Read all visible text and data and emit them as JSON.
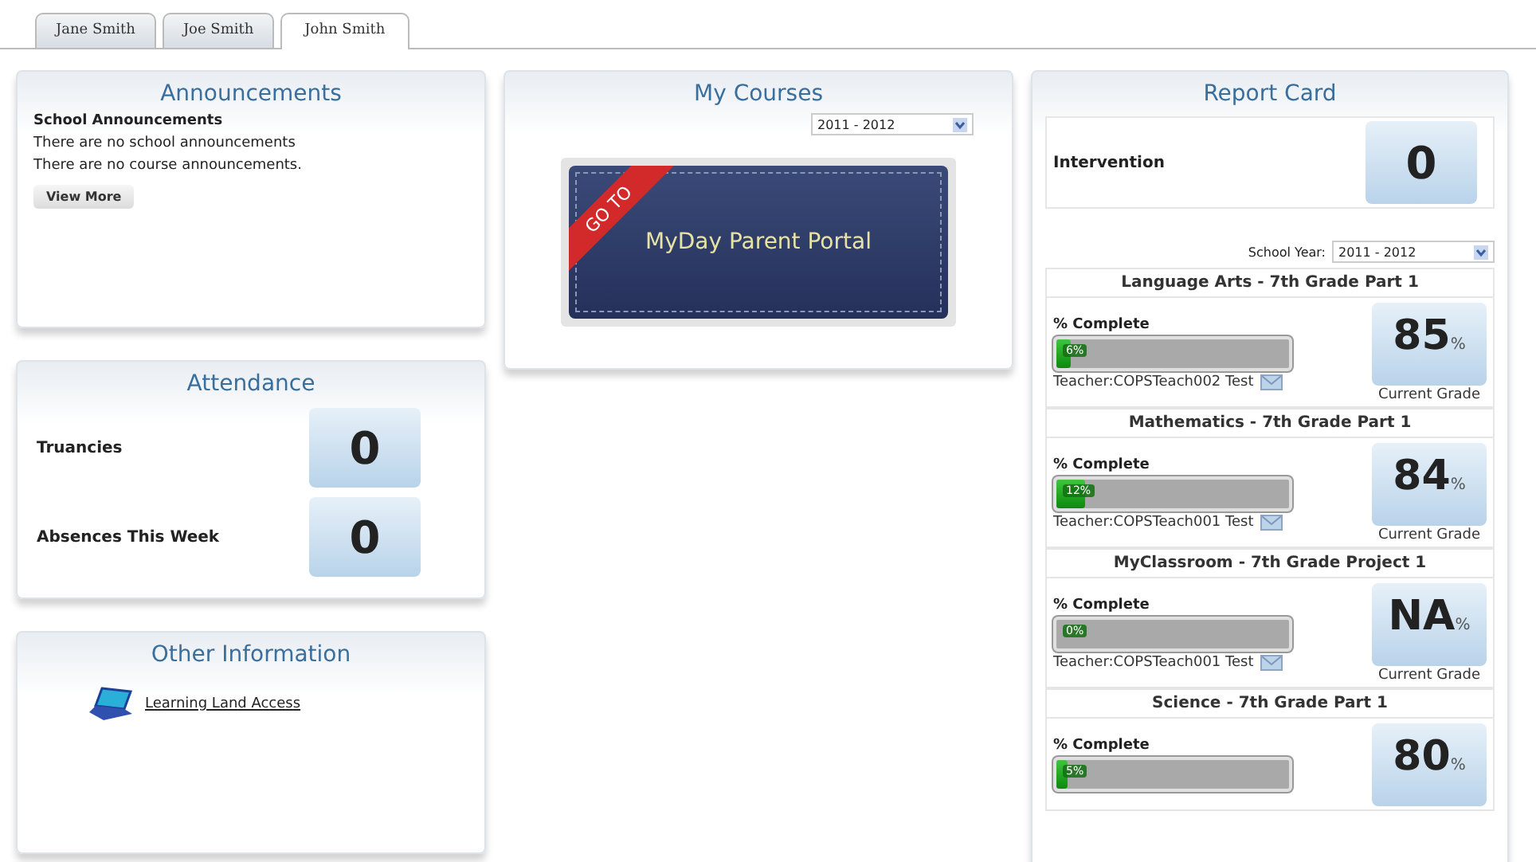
{
  "tabs": [
    {
      "label": "Jane Smith",
      "selected": false
    },
    {
      "label": "Joe Smith",
      "selected": false
    },
    {
      "label": "John Smith",
      "selected": true
    }
  ],
  "announcements": {
    "title": "Announcements",
    "heading": "School Announcements",
    "lines": [
      "There are no school announcements",
      "There are no course announcements."
    ],
    "button": "View More"
  },
  "attendance": {
    "title": "Attendance",
    "rows": [
      {
        "label": "Truancies",
        "value": "0"
      },
      {
        "label": "Absences This Week",
        "value": "0"
      }
    ]
  },
  "other_information": {
    "title": "Other Information",
    "links": [
      "Learning Land Access"
    ]
  },
  "my_courses": {
    "title": "My Courses",
    "year": "2011 - 2012",
    "banner_ribbon": "GO TO",
    "banner_text": "MyDay Parent Portal"
  },
  "report_card": {
    "title": "Report Card",
    "intervention": {
      "label": "Intervention",
      "value": "0"
    },
    "school_year_label": "School Year:",
    "school_year": "2011 - 2012",
    "courses": [
      {
        "title": "Language Arts - 7th Grade Part 1",
        "complete_label": "% Complete",
        "level": 0.06,
        "percent": "6%",
        "teacher": "Teacher:COPSTeach002 Test",
        "grade": "85",
        "unit": "%",
        "grade_label": "Current Grade"
      },
      {
        "title": "Mathematics - 7th Grade Part 1",
        "complete_label": "% Complete",
        "level": 0.12,
        "percent": "12%",
        "teacher": "Teacher:COPSTeach001 Test",
        "grade": "84",
        "unit": "%",
        "grade_label": "Current Grade"
      },
      {
        "title": "MyClassroom - 7th Grade Project 1",
        "complete_label": "% Complete",
        "level": 0,
        "percent": "0%",
        "teacher": "Teacher:COPSTeach001 Test",
        "grade": "NA",
        "unit": "%",
        "grade_label": "Current Grade"
      },
      {
        "title": "Science - 7th Grade Part 1",
        "complete_label": "% Complete",
        "level": 0.05,
        "percent": "5%",
        "grade": "80",
        "unit": "%"
      }
    ]
  }
}
